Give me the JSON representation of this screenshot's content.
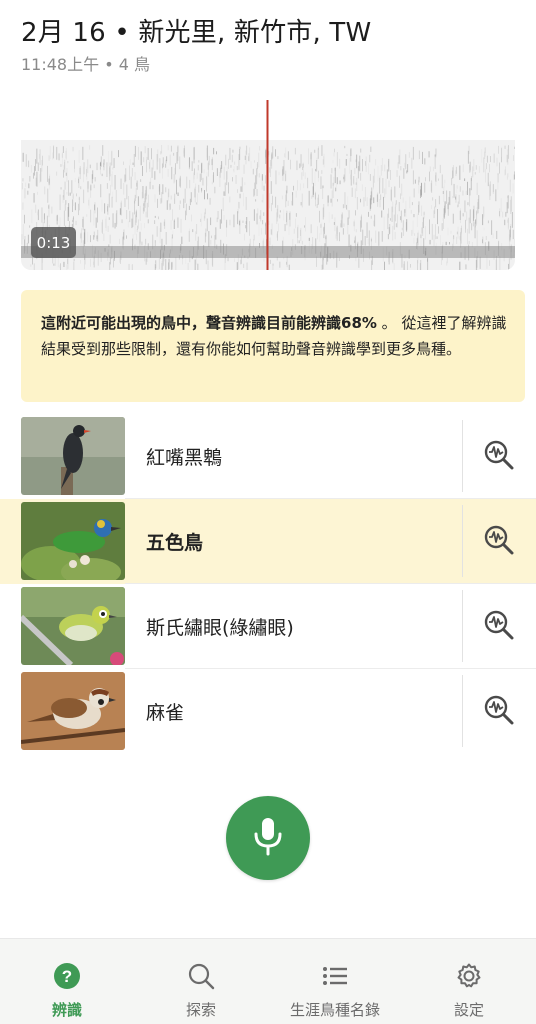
{
  "header": {
    "title": "2月 16 • 新光里, 新竹市, TW",
    "subtitle": "11:48上午 • 4 鳥"
  },
  "spectrogram": {
    "time": "0:13",
    "playhead_color": "#c0392b"
  },
  "notice": {
    "bold": "這附近可能出現的鳥中，聲音辨識目前能辨識68%",
    "rest": " 。 從這裡了解辨識結果受到那些限制，還有你能如何幫助聲音辨識學到更多鳥種。"
  },
  "species": [
    {
      "name": "紅嘴黑鵯",
      "selected": false
    },
    {
      "name": "五色鳥",
      "selected": true
    },
    {
      "name": "斯氏繡眼(綠繡眼)",
      "selected": false
    },
    {
      "name": "麻雀",
      "selected": false
    }
  ],
  "nav": [
    {
      "label": "辨識",
      "icon": "question-circle-icon",
      "active": true
    },
    {
      "label": "探索",
      "icon": "search-icon",
      "active": false
    },
    {
      "label": "生涯鳥種名錄",
      "icon": "list-icon",
      "active": false
    },
    {
      "label": "設定",
      "icon": "gear-icon",
      "active": false
    }
  ],
  "colors": {
    "accent": "#3f9a55",
    "notice_bg": "#fdf3c9",
    "selected_row": "#fdf5d4"
  }
}
